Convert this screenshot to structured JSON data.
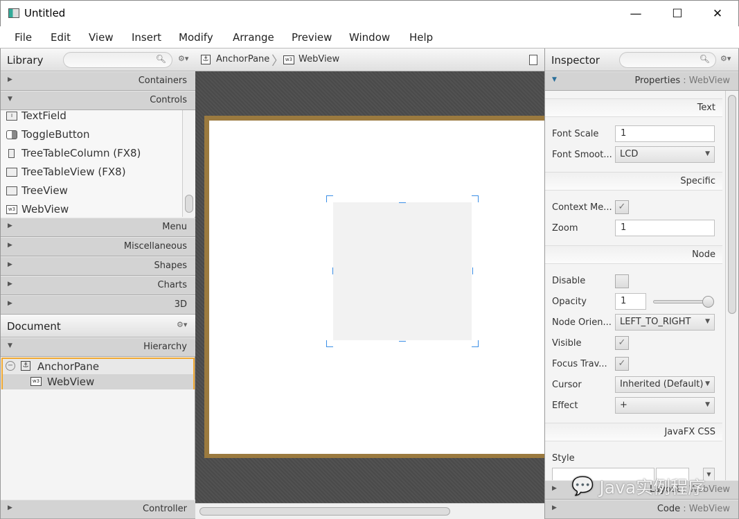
{
  "window": {
    "title": "Untitled",
    "minimize": "—",
    "maximize": "☐",
    "close": "✕"
  },
  "menu": [
    "File",
    "Edit",
    "View",
    "Insert",
    "Modify",
    "Arrange",
    "Preview",
    "Window",
    "Help"
  ],
  "library": {
    "title": "Library",
    "search_placeholder": "",
    "sections_top": [
      "Containers",
      "Controls"
    ],
    "items": [
      {
        "icon": "I",
        "label": "TextField"
      },
      {
        "icon": "",
        "label": "ToggleButton"
      },
      {
        "icon": "",
        "label": "TreeTableColumn  (FX8)"
      },
      {
        "icon": "",
        "label": "TreeTableView  (FX8)"
      },
      {
        "icon": "",
        "label": "TreeView"
      },
      {
        "icon": "w3",
        "label": "WebView"
      }
    ],
    "sections_bottom": [
      "Menu",
      "Miscellaneous",
      "Shapes",
      "Charts",
      "3D"
    ]
  },
  "document": {
    "title": "Document",
    "hierarchy": "Hierarchy",
    "tree": [
      "AnchorPane",
      "WebView"
    ],
    "controller": "Controller"
  },
  "breadcrumb": [
    "AnchorPane",
    "WebView"
  ],
  "inspector": {
    "title": "Inspector",
    "properties_label": "Properties",
    "properties_target": ": WebView",
    "sections": {
      "text": "Text",
      "specific": "Specific",
      "node": "Node",
      "css": "JavaFX CSS"
    },
    "props": {
      "font_scale_label": "Font Scale",
      "font_scale": "1",
      "font_smoothing_label": "Font Smoot...",
      "font_smoothing": "LCD",
      "context_menu_label": "Context Me...",
      "context_menu_enabled": true,
      "zoom_label": "Zoom",
      "zoom": "1",
      "disable_label": "Disable",
      "disable": false,
      "opacity_label": "Opacity",
      "opacity": "1",
      "opacity_slider": 1.0,
      "node_orientation_label": "Node Orien...",
      "node_orientation": "LEFT_TO_RIGHT",
      "visible_label": "Visible",
      "visible": true,
      "focus_traversable_label": "Focus Trav...",
      "focus_traversable": true,
      "cursor_label": "Cursor",
      "cursor": "Inherited (Default)",
      "effect_label": "Effect",
      "effect": "+",
      "style_label": "Style"
    },
    "layout_label": "Layout",
    "code_label": "Code",
    "target": ": WebView"
  },
  "watermark": "Java实例程序",
  "colors": {
    "canvas": "#4d4d4d",
    "pane_border": "#9b7a3f",
    "selection": "#f0a830",
    "accent": "#3a8ee6"
  }
}
